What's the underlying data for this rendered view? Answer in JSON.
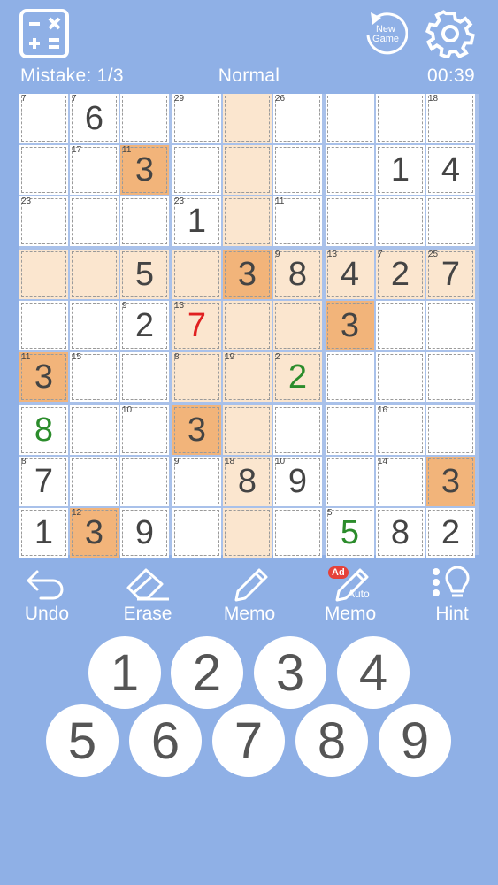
{
  "header": {
    "calculator_icon": "calculator-icon",
    "new_game_label": "New\nGame",
    "settings_icon": "gear-icon"
  },
  "status": {
    "mistake": "Mistake: 1/3",
    "difficulty": "Normal",
    "timer": "00:39"
  },
  "board": {
    "cells": [
      [
        {
          "v": "",
          "s": "7"
        },
        {
          "v": "6",
          "s": "7"
        },
        {
          "v": "",
          "s": ""
        },
        {
          "v": "",
          "s": "29"
        },
        {
          "v": "",
          "s": "",
          "h": "hl"
        },
        {
          "v": "",
          "s": "26"
        },
        {
          "v": "",
          "s": ""
        },
        {
          "v": "",
          "s": ""
        },
        {
          "v": "",
          "s": "18"
        }
      ],
      [
        {
          "v": "",
          "s": ""
        },
        {
          "v": "",
          "s": "17"
        },
        {
          "v": "3",
          "s": "11",
          "h": "orange"
        },
        {
          "v": "",
          "s": ""
        },
        {
          "v": "",
          "s": "",
          "h": "hl"
        },
        {
          "v": "",
          "s": ""
        },
        {
          "v": "",
          "s": ""
        },
        {
          "v": "1",
          "s": ""
        },
        {
          "v": "4",
          "s": ""
        }
      ],
      [
        {
          "v": "",
          "s": "23"
        },
        {
          "v": "",
          "s": ""
        },
        {
          "v": "",
          "s": ""
        },
        {
          "v": "1",
          "s": "23"
        },
        {
          "v": "",
          "s": "",
          "h": "hl"
        },
        {
          "v": "",
          "s": "11"
        },
        {
          "v": "",
          "s": ""
        },
        {
          "v": "",
          "s": ""
        },
        {
          "v": "",
          "s": ""
        }
      ],
      [
        {
          "v": "",
          "s": "",
          "h": "hl"
        },
        {
          "v": "",
          "s": "",
          "h": "hl"
        },
        {
          "v": "5",
          "s": "",
          "h": "hl"
        },
        {
          "v": "",
          "s": "",
          "h": "hl"
        },
        {
          "v": "3",
          "s": "",
          "h": "orange"
        },
        {
          "v": "8",
          "s": "9",
          "h": "hl"
        },
        {
          "v": "4",
          "s": "13",
          "h": "hl"
        },
        {
          "v": "2",
          "s": "7",
          "h": "hl"
        },
        {
          "v": "7",
          "s": "25",
          "h": "hl"
        }
      ],
      [
        {
          "v": "",
          "s": ""
        },
        {
          "v": "",
          "s": ""
        },
        {
          "v": "2",
          "s": "9"
        },
        {
          "v": "7",
          "s": "13",
          "h": "hl",
          "c": "red"
        },
        {
          "v": "",
          "s": "",
          "h": "hl"
        },
        {
          "v": "",
          "s": "",
          "h": "hl"
        },
        {
          "v": "3",
          "s": "",
          "h": "orange"
        },
        {
          "v": "",
          "s": ""
        },
        {
          "v": "",
          "s": ""
        }
      ],
      [
        {
          "v": "3",
          "s": "11",
          "h": "orange"
        },
        {
          "v": "",
          "s": "15"
        },
        {
          "v": "",
          "s": ""
        },
        {
          "v": "",
          "s": "8",
          "h": "hl"
        },
        {
          "v": "",
          "s": "19",
          "h": "hl"
        },
        {
          "v": "2",
          "s": "2",
          "h": "hl",
          "c": "green"
        },
        {
          "v": "",
          "s": ""
        },
        {
          "v": "",
          "s": ""
        },
        {
          "v": "",
          "s": ""
        }
      ],
      [
        {
          "v": "8",
          "s": "",
          "c": "green"
        },
        {
          "v": "",
          "s": ""
        },
        {
          "v": "",
          "s": "10"
        },
        {
          "v": "3",
          "s": "",
          "h": "orange"
        },
        {
          "v": "",
          "s": "",
          "h": "hl"
        },
        {
          "v": "",
          "s": ""
        },
        {
          "v": "",
          "s": ""
        },
        {
          "v": "",
          "s": "16"
        },
        {
          "v": "",
          "s": ""
        }
      ],
      [
        {
          "v": "7",
          "s": "8"
        },
        {
          "v": "",
          "s": ""
        },
        {
          "v": "",
          "s": ""
        },
        {
          "v": "",
          "s": "9"
        },
        {
          "v": "8",
          "s": "18",
          "h": "hl"
        },
        {
          "v": "9",
          "s": "10"
        },
        {
          "v": "",
          "s": ""
        },
        {
          "v": "",
          "s": "14"
        },
        {
          "v": "3",
          "s": "",
          "h": "orange"
        }
      ],
      [
        {
          "v": "1",
          "s": ""
        },
        {
          "v": "3",
          "s": "12",
          "h": "orange"
        },
        {
          "v": "9",
          "s": ""
        },
        {
          "v": "",
          "s": ""
        },
        {
          "v": "",
          "s": "",
          "h": "hl"
        },
        {
          "v": "",
          "s": ""
        },
        {
          "v": "5",
          "s": "5",
          "c": "green"
        },
        {
          "v": "8",
          "s": ""
        },
        {
          "v": "2",
          "s": ""
        }
      ]
    ]
  },
  "tools": {
    "undo": "Undo",
    "erase": "Erase",
    "memo": "Memo",
    "auto_memo": "Memo",
    "auto_badge": "Ad",
    "auto_small": "Auto",
    "hint": "Hint"
  },
  "numpad": [
    "1",
    "2",
    "3",
    "4",
    "5",
    "6",
    "7",
    "8",
    "9"
  ]
}
